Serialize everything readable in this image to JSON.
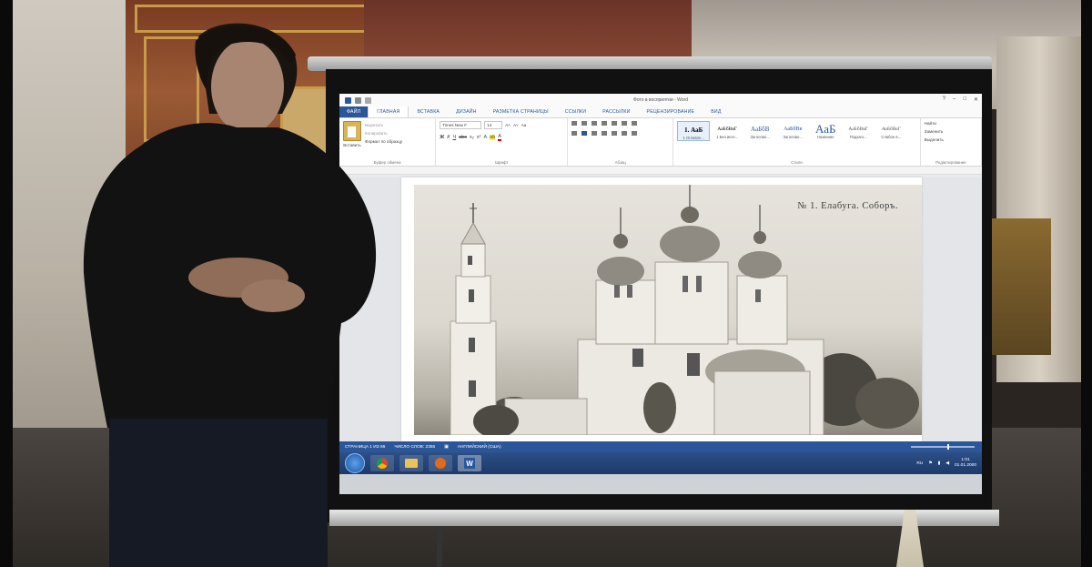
{
  "word": {
    "title": "Фото в восприятии - Word",
    "tabs": [
      "ФАЙЛ",
      "ГЛАВНАЯ",
      "ВСТАВКА",
      "ДИЗАЙН",
      "РАЗМЕТКА СТРАНИЦЫ",
      "ССЫЛКИ",
      "РАССЫЛКИ",
      "РЕЦЕНЗИРОВАНИЕ",
      "ВИД"
    ],
    "clipboard": {
      "paste": "Вставить",
      "cut": "Вырезать",
      "copy": "Копировать",
      "format_painter": "Формат по образцу",
      "group": "Буфер обмена"
    },
    "font": {
      "name": "Times New F",
      "size": "14",
      "group": "Шрифт"
    },
    "paragraph": {
      "group": "Абзац"
    },
    "styles": {
      "group": "Стили",
      "items": [
        {
          "preview": "1. АаБ",
          "name": "1 Оглавле..."
        },
        {
          "preview": "АаБбВвГ",
          "name": "1 Без инте..."
        },
        {
          "preview": "АаБбВ",
          "name": "Заголово..."
        },
        {
          "preview": "АаБбВв",
          "name": "Заголово..."
        },
        {
          "preview": "АаБ",
          "name": "Название"
        },
        {
          "preview": "АаБбВвГ",
          "name": "Подзаго..."
        },
        {
          "preview": "АаБбВвГ",
          "name": "Слабое в..."
        }
      ]
    },
    "editing": {
      "find": "Найти",
      "replace": "Заменить",
      "select": "Выделить",
      "group": "Редактирование"
    },
    "document": {
      "caption": "№ 1.  Елабуга. Соборъ."
    },
    "status": {
      "page": "СТРАНИЦА 1 ИЗ 66",
      "words": "ЧИСЛО СЛОВ: 2355",
      "language": "АНГЛИЙСКИЙ (США)"
    }
  },
  "taskbar": {
    "lang": "RU",
    "time": "1:01",
    "date": "01.01.2000"
  }
}
